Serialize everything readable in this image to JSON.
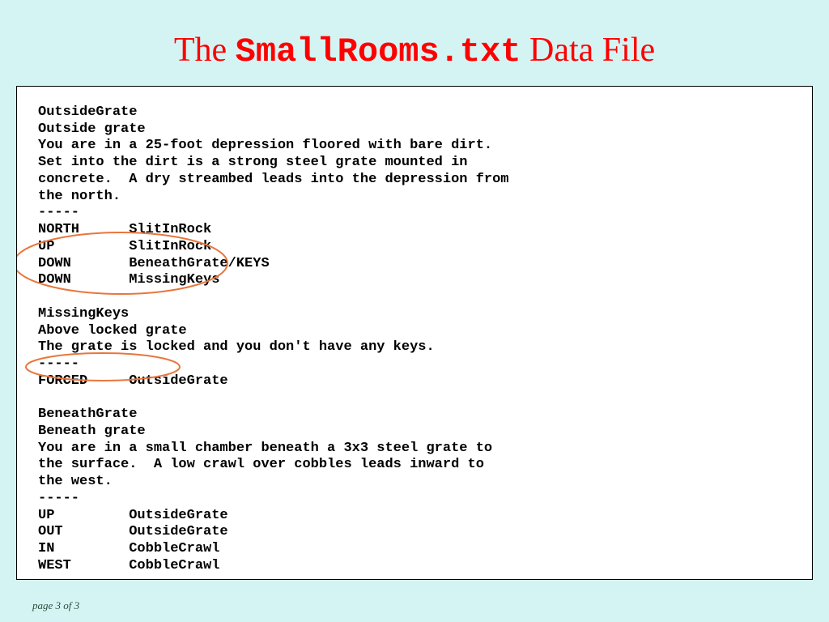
{
  "title": {
    "prefix": "The ",
    "filename": "SmallRooms.txt",
    "suffix": " Data File"
  },
  "file_lines": [
    "OutsideGrate",
    "Outside grate",
    "You are in a 25-foot depression floored with bare dirt.",
    "Set into the dirt is a strong steel grate mounted in",
    "concrete.  A dry streambed leads into the depression from",
    "the north.",
    "-----",
    "NORTH      SlitInRock",
    "UP         SlitInRock",
    "DOWN       BeneathGrate/KEYS",
    "DOWN       MissingKeys",
    "",
    "MissingKeys",
    "Above locked grate",
    "The grate is locked and you don't have any keys.",
    "-----",
    "FORCED     OutsideGrate",
    "",
    "BeneathGrate",
    "Beneath grate",
    "You are in a small chamber beneath a 3x3 steel grate to",
    "the surface.  A low crawl over cobbles leads inward to",
    "the west.",
    "-----",
    "UP         OutsideGrate",
    "OUT        OutsideGrate",
    "IN         CobbleCrawl",
    "WEST       CobbleCrawl"
  ],
  "footer": "page 3 of 3",
  "colors": {
    "background": "#d4f4f4",
    "title": "#ff0000",
    "annotation": "#e8763c"
  }
}
